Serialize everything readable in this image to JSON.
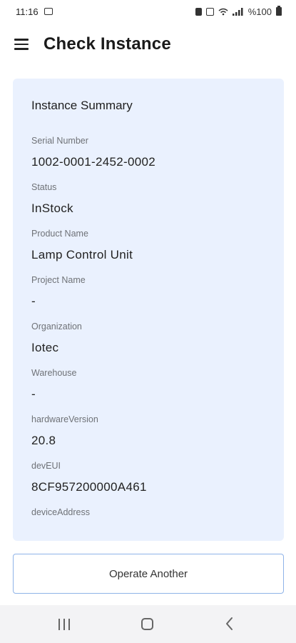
{
  "status_bar": {
    "time": "11:16",
    "battery_text": "%100",
    "icons": [
      "image-icon",
      "lock-icon",
      "nfc-icon",
      "wifi-icon",
      "signal-icon",
      "battery-icon"
    ]
  },
  "app_bar": {
    "title": "Check Instance",
    "menu_icon": "hamburger-menu-icon"
  },
  "card": {
    "title": "Instance Summary",
    "background_color": "#eaf1fe",
    "fields": [
      {
        "label": "Serial Number",
        "value": "1002-0001-2452-0002"
      },
      {
        "label": "Status",
        "value": "InStock"
      },
      {
        "label": "Product Name",
        "value": "Lamp Control Unit"
      },
      {
        "label": "Project Name",
        "value": "-"
      },
      {
        "label": "Organization",
        "value": "Iotec"
      },
      {
        "label": "Warehouse",
        "value": "-"
      },
      {
        "label": "hardwareVersion",
        "value": "20.8"
      },
      {
        "label": "devEUI",
        "value": "8CF957200000A461"
      },
      {
        "label": "deviceAddress",
        "value": ""
      }
    ]
  },
  "actions": {
    "operate_another_label": "Operate Another",
    "border_color": "#8fb3e8"
  },
  "nav_bar": {
    "icons": [
      "recent-apps-icon",
      "home-icon",
      "back-icon"
    ]
  }
}
